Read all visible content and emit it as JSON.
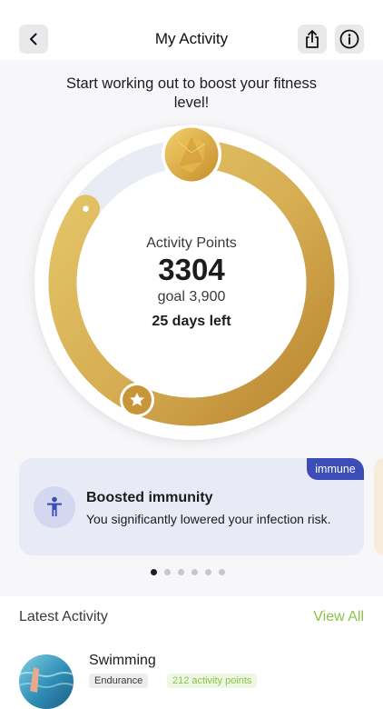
{
  "header": {
    "title": "My Activity",
    "back_icon": "chevron-left-icon",
    "share_icon": "share-icon",
    "info_icon": "info-icon"
  },
  "subtitle": "Start working out to boost your fitness level!",
  "activity": {
    "label": "Activity Points",
    "points": "3304",
    "goal_text": "goal 3,900",
    "days_left": "25 days left",
    "progress_fraction": 0.847
  },
  "card": {
    "badge": "immune",
    "title": "Boosted immunity",
    "description": "You significantly lowered your infection risk.",
    "icon": "person-icon",
    "accent": "#3d4db7"
  },
  "carousel": {
    "count": 6,
    "active": 0
  },
  "latest": {
    "title": "Latest Activity",
    "view_all": "View All",
    "items": [
      {
        "name": "Swimming",
        "tag": "Endurance",
        "points_text": "212 activity points"
      }
    ]
  },
  "colors": {
    "gold": "#d9b55a",
    "gold_dark": "#b8873a",
    "track": "#e9ecf5",
    "link_green": "#8bc34a"
  }
}
